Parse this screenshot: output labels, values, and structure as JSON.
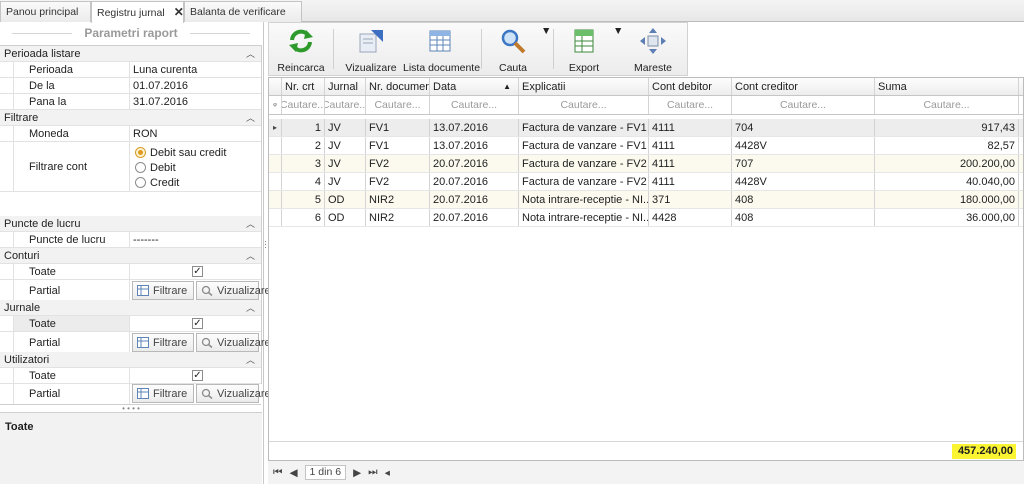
{
  "tabs": [
    {
      "label": "Panou principal"
    },
    {
      "label": "Registru jurnal"
    },
    {
      "label": "Balanta de verificare"
    }
  ],
  "panel": {
    "title": "Parametri raport",
    "perioada": {
      "cat": "Perioada listare",
      "perioada_label": "Perioada",
      "perioada_value": "Luna curenta",
      "dela_label": "De la",
      "dela_value": "01.07.2016",
      "panala_label": "Pana la",
      "panala_value": "31.07.2016"
    },
    "filtrare": {
      "cat": "Filtrare",
      "moneda_label": "Moneda",
      "moneda_value": "RON",
      "cont_label": "Filtrare cont",
      "options": [
        "Debit sau credit",
        "Debit",
        "Credit"
      ],
      "selected": "Debit sau credit"
    },
    "puncte": {
      "cat": "Puncte de lucru",
      "label": "Puncte de lucru",
      "value": "-------"
    },
    "conturi": {
      "cat": "Conturi",
      "toate": "Toate",
      "partial": "Partial",
      "toate_checked": "✓"
    },
    "jurnale": {
      "cat": "Jurnale",
      "toate": "Toate",
      "partial": "Partial",
      "toate_checked": "✓"
    },
    "utilizatori": {
      "cat": "Utilizatori",
      "toate": "Toate",
      "partial": "Partial",
      "toate_checked": "✓"
    },
    "btn_filtrare": "Filtrare",
    "btn_vizualizare": "Vizualizare",
    "description": "Toate"
  },
  "toolbar": {
    "reincarca": "Reincarca",
    "vizualizare": "Vizualizare",
    "lista": "Lista documente",
    "cauta": "Cauta",
    "export": "Export",
    "mareste": "Mareste"
  },
  "grid": {
    "columns": [
      "Nr. crt",
      "Jurnal",
      "Nr. document",
      "Data",
      "Explicatii",
      "Cont debitor",
      "Cont creditor",
      "Suma"
    ],
    "filters": [
      "Cautare...",
      "Cautare...",
      "Cautare...",
      "Cautare...",
      "Cautare...",
      "Cautare...",
      "Cautare...",
      "Cautare..."
    ],
    "rows": [
      {
        "nr": "1",
        "jurnal": "JV",
        "doc": "FV1",
        "data": "13.07.2016",
        "expl": "Factura de vanzare - FV1 ...",
        "deb": "4111",
        "cred": "704",
        "suma": "917,43"
      },
      {
        "nr": "2",
        "jurnal": "JV",
        "doc": "FV1",
        "data": "13.07.2016",
        "expl": "Factura de vanzare - FV1 ...",
        "deb": "4111",
        "cred": "4428V",
        "suma": "82,57"
      },
      {
        "nr": "3",
        "jurnal": "JV",
        "doc": "FV2",
        "data": "20.07.2016",
        "expl": "Factura de vanzare - FV2 ...",
        "deb": "4111",
        "cred": "707",
        "suma": "200.200,00"
      },
      {
        "nr": "4",
        "jurnal": "JV",
        "doc": "FV2",
        "data": "20.07.2016",
        "expl": "Factura de vanzare - FV2 ...",
        "deb": "4111",
        "cred": "4428V",
        "suma": "40.040,00"
      },
      {
        "nr": "5",
        "jurnal": "OD",
        "doc": "NIR2",
        "data": "20.07.2016",
        "expl": "Nota intrare-receptie - NI...",
        "deb": "371",
        "cred": "408",
        "suma": "180.000,00"
      },
      {
        "nr": "6",
        "jurnal": "OD",
        "doc": "NIR2",
        "data": "20.07.2016",
        "expl": "Nota intrare-receptie - NI...",
        "deb": "4428",
        "cred": "408",
        "suma": "36.000,00"
      }
    ],
    "total": "457.240,00"
  },
  "pager": {
    "page": "1 din 6"
  },
  "colors": {
    "highlight": "#fbf433",
    "accent": "#e09a1e"
  }
}
